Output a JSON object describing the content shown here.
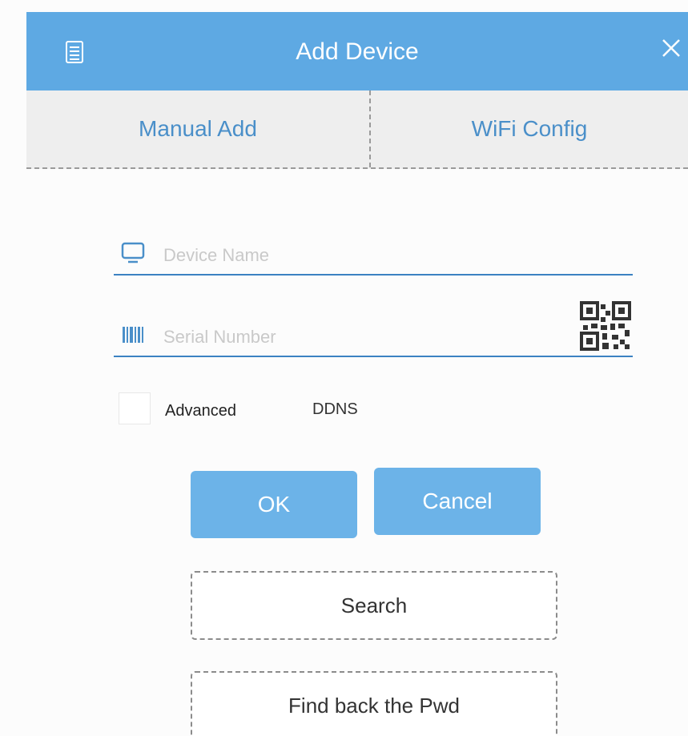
{
  "header": {
    "title": "Add Device",
    "menu_icon": "list-icon",
    "close_icon": "close-icon",
    "background_color": "#5ea9e3"
  },
  "tabs": [
    {
      "label": "Manual Add",
      "active": true
    },
    {
      "label": "WiFi Config",
      "active": false
    }
  ],
  "form": {
    "device_name": {
      "placeholder": "Device Name",
      "value": "",
      "icon": "monitor-icon"
    },
    "serial_number": {
      "placeholder": "Serial Number",
      "value": "",
      "icon": "barcode-icon",
      "scan_icon": "qr-code-icon"
    },
    "advanced": {
      "label": "Advanced",
      "checked": false
    },
    "ddns_label": "DDNS"
  },
  "buttons": {
    "ok": "OK",
    "cancel": "Cancel",
    "search": "Search",
    "find_pwd": "Find back the Pwd"
  },
  "colors": {
    "accent": "#5ea9e3",
    "button": "#6cb3e8",
    "tab_text": "#4a8fc9"
  }
}
